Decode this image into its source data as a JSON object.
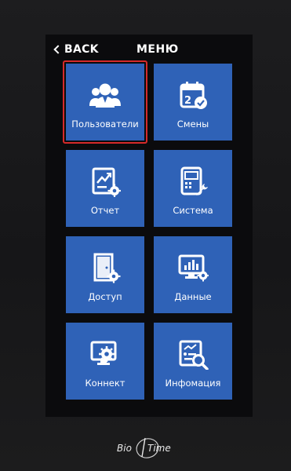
{
  "header": {
    "back_label": "BACK",
    "title": "МЕНЮ"
  },
  "menu": {
    "selected_item": "users",
    "items": [
      {
        "id": "users",
        "label": "Пользователи",
        "icon": "users-icon"
      },
      {
        "id": "shifts",
        "label": "Смены",
        "icon": "calendar-check-icon"
      },
      {
        "id": "report",
        "label": "Отчет",
        "icon": "report-chart-icon"
      },
      {
        "id": "system",
        "label": "Система",
        "icon": "device-wrench-icon"
      },
      {
        "id": "access",
        "label": "Доступ",
        "icon": "door-gear-icon"
      },
      {
        "id": "data",
        "label": "Данные",
        "icon": "monitor-chart-gear-icon"
      },
      {
        "id": "connect",
        "label": "Коннект",
        "icon": "monitor-gear-icon"
      },
      {
        "id": "info",
        "label": "Инфомация",
        "icon": "document-search-icon"
      }
    ]
  },
  "branding": {
    "logo_text": "BioTime"
  },
  "colors": {
    "tile": "#2f62b7",
    "selected_outline": "#d52a2a",
    "screen_background": "#0b0b0d"
  }
}
